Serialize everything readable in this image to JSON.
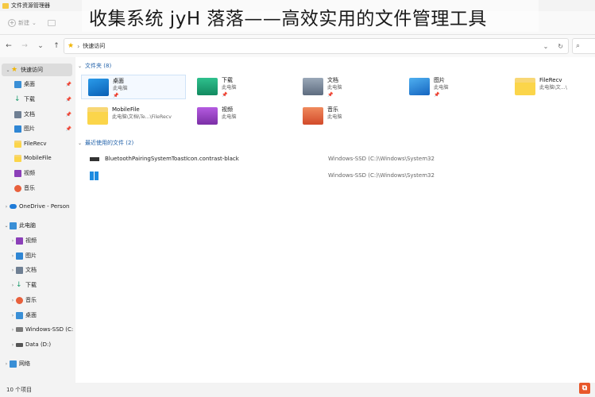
{
  "window": {
    "title": "文件资源管理器"
  },
  "banner": {
    "text": "收集系统 jyH 落落——高效实用的文件管理工具"
  },
  "toolbar": {
    "new_label": "新建"
  },
  "address": {
    "path": "快速访问"
  },
  "sidebar": {
    "items": [
      {
        "label": "快速访问",
        "icon": "star-icon"
      },
      {
        "label": "桌面",
        "icon": "desktop-icon"
      },
      {
        "label": "下载",
        "icon": "download-icon"
      },
      {
        "label": "文档",
        "icon": "document-icon"
      },
      {
        "label": "图片",
        "icon": "picture-icon"
      },
      {
        "label": "FileRecv",
        "icon": "folder-icon"
      },
      {
        "label": "MobileFile",
        "icon": "folder-icon"
      },
      {
        "label": "视频",
        "icon": "video-icon"
      },
      {
        "label": "音乐",
        "icon": "music-icon"
      },
      {
        "label": "OneDrive - Person",
        "icon": "cloud-icon"
      },
      {
        "label": "此电脑",
        "icon": "computer-icon"
      },
      {
        "label": "视频",
        "icon": "video-icon"
      },
      {
        "label": "图片",
        "icon": "picture-icon"
      },
      {
        "label": "文档",
        "icon": "document-icon"
      },
      {
        "label": "下载",
        "icon": "download-icon"
      },
      {
        "label": "音乐",
        "icon": "music-icon"
      },
      {
        "label": "桌面",
        "icon": "desktop-icon"
      },
      {
        "label": "Windows-SSD (C:",
        "icon": "drive-icon"
      },
      {
        "label": "Data (D:)",
        "icon": "drive-icon"
      },
      {
        "label": "网络",
        "icon": "network-icon"
      }
    ]
  },
  "folders": {
    "header": "文件夹 (8)",
    "items": [
      {
        "name": "桌面",
        "sub": "此电脑",
        "pinned": true
      },
      {
        "name": "下载",
        "sub": "此电脑",
        "pinned": true
      },
      {
        "name": "文档",
        "sub": "此电脑",
        "pinned": true
      },
      {
        "name": "图片",
        "sub": "此电脑",
        "pinned": true
      },
      {
        "name": "FileRecv",
        "sub": "此电脑\\文...\\",
        "pinned": false
      },
      {
        "name": "MobileFile",
        "sub": "此电脑\\文档\\Te...\\FileRecv",
        "pinned": false
      },
      {
        "name": "视频",
        "sub": "此电脑",
        "pinned": false
      },
      {
        "name": "音乐",
        "sub": "此电脑",
        "pinned": false
      }
    ]
  },
  "recent": {
    "header": "最近使用的文件 (2)",
    "items": [
      {
        "name": "BluetoothPairingSystemToastIcon.contrast-black",
        "location": "Windows-SSD (C:)\\Windows\\System32"
      },
      {
        "name": "",
        "location": "Windows-SSD (C:)\\Windows\\System32"
      }
    ]
  },
  "status": {
    "count": "10 个项目"
  },
  "colors": {
    "accent": "#1e5fa8",
    "folder": "#fbd54a",
    "selection": "#dcdcdc"
  }
}
